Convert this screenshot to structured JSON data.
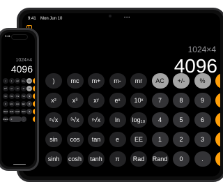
{
  "ipad": {
    "status_time": "9:41",
    "status_date": "Mon Jun 10",
    "dots": "•••",
    "expression": "1024×4",
    "result": "4096",
    "rows": [
      [
        {
          "l": ")",
          "t": "fn"
        },
        {
          "l": "mc",
          "t": "fn"
        },
        {
          "l": "m+",
          "t": "fn"
        },
        {
          "l": "m-",
          "t": "fn"
        },
        {
          "l": "mr",
          "t": "fn"
        },
        {
          "l": "AC",
          "t": "gray"
        },
        {
          "l": "+/-",
          "t": "gray"
        },
        {
          "l": "%",
          "t": "gray"
        },
        {
          "l": "÷",
          "t": "orange"
        }
      ],
      [
        {
          "l": "x²",
          "t": "fn"
        },
        {
          "l": "x³",
          "t": "fn"
        },
        {
          "l": "xʸ",
          "t": "fn"
        },
        {
          "l": "eˣ",
          "t": "fn"
        },
        {
          "l": "10ˣ",
          "t": "fn"
        },
        {
          "l": "7",
          "t": "dark"
        },
        {
          "l": "8",
          "t": "dark"
        },
        {
          "l": "9",
          "t": "dark"
        },
        {
          "l": "×",
          "t": "orange"
        }
      ],
      [
        {
          "l": "²√x",
          "t": "fn"
        },
        {
          "l": "³√x",
          "t": "fn"
        },
        {
          "l": "ʸ√x",
          "t": "fn"
        },
        {
          "l": "ln",
          "t": "fn"
        },
        {
          "l": "log₁₀",
          "t": "fn"
        },
        {
          "l": "4",
          "t": "dark"
        },
        {
          "l": "5",
          "t": "dark"
        },
        {
          "l": "6",
          "t": "dark"
        },
        {
          "l": "−",
          "t": "orange"
        }
      ],
      [
        {
          "l": "sin",
          "t": "fn"
        },
        {
          "l": "cos",
          "t": "fn"
        },
        {
          "l": "tan",
          "t": "fn"
        },
        {
          "l": "e",
          "t": "fn"
        },
        {
          "l": "EE",
          "t": "fn"
        },
        {
          "l": "1",
          "t": "dark"
        },
        {
          "l": "2",
          "t": "dark"
        },
        {
          "l": "3",
          "t": "dark"
        },
        {
          "l": "+",
          "t": "orange"
        }
      ],
      [
        {
          "l": "sinh",
          "t": "fn"
        },
        {
          "l": "cosh",
          "t": "fn"
        },
        {
          "l": "tanh",
          "t": "fn"
        },
        {
          "l": "π",
          "t": "fn"
        },
        {
          "l": "Rad",
          "t": "fn"
        },
        {
          "l": "Rand",
          "t": "fn"
        },
        {
          "l": "0",
          "t": "dark"
        },
        {
          "l": ".",
          "t": "dark"
        },
        {
          "l": "=",
          "t": "orange"
        }
      ]
    ]
  },
  "iphone": {
    "status_time": "9:41",
    "expression": "1024×4",
    "result": "4096",
    "rows": [
      [
        {
          "l": "(",
          "t": "fn"
        },
        {
          "l": ")",
          "t": "fn"
        },
        {
          "l": "mc",
          "t": "fn"
        },
        {
          "l": "m+",
          "t": "fn"
        },
        {
          "l": "AC",
          "t": "gray"
        },
        {
          "l": "÷",
          "t": "orange"
        }
      ],
      [
        {
          "l": "2ⁿᵈ",
          "t": "fn"
        },
        {
          "l": "x²",
          "t": "fn"
        },
        {
          "l": "x³",
          "t": "fn"
        },
        {
          "l": "xʸ",
          "t": "fn"
        },
        {
          "l": "%",
          "t": "gray"
        },
        {
          "l": "×",
          "t": "orange"
        }
      ],
      [
        {
          "l": "¹/x",
          "t": "fn"
        },
        {
          "l": "²√x",
          "t": "fn"
        },
        {
          "l": "³√x",
          "t": "fn"
        },
        {
          "l": "ʸ√x",
          "t": "fn"
        },
        {
          "l": "9",
          "t": "dark"
        },
        {
          "l": "−",
          "t": "orange"
        }
      ],
      [
        {
          "l": "x!",
          "t": "fn"
        },
        {
          "l": "sin",
          "t": "fn"
        },
        {
          "l": "cos",
          "t": "fn"
        },
        {
          "l": "tan",
          "t": "fn"
        },
        {
          "l": "6",
          "t": "dark"
        },
        {
          "l": "+",
          "t": "orange"
        }
      ],
      [
        {
          "l": "Rad",
          "t": "fn"
        },
        {
          "l": "sinh",
          "t": "fn"
        },
        {
          "l": "cosh",
          "t": "fn"
        },
        {
          "l": "tanh",
          "t": "fn"
        },
        {
          "l": "3",
          "t": "dark"
        },
        {
          "l": "=",
          "t": "orange"
        }
      ],
      [
        {
          "l": "Rand",
          "t": "fn"
        },
        {
          "l": "0",
          "t": "dark"
        },
        {
          "l": ".",
          "t": "dark"
        },
        {
          "l": "",
          "t": "orange"
        }
      ]
    ]
  },
  "colors": {
    "accent": "#ff9f0a",
    "key_dark": "#333336",
    "key_gray": "#a5a5a5",
    "background": "#000000"
  }
}
